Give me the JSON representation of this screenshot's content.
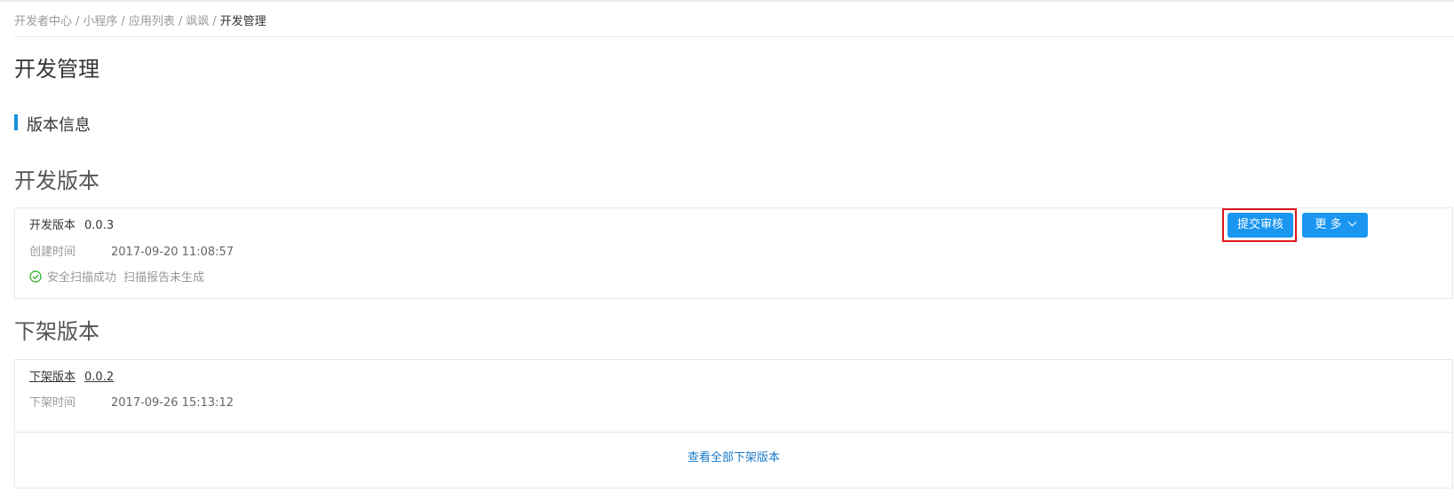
{
  "breadcrumb": {
    "items": [
      "开发者中心",
      "小程序",
      "应用列表",
      "飒飒",
      "开发管理"
    ],
    "separator": "/"
  },
  "page_title": "开发管理",
  "section_title": "版本信息",
  "dev_group": {
    "title": "开发版本",
    "version_label": "开发版本",
    "version_value": "0.0.3",
    "created_label": "创建时间",
    "created_value": "2017-09-20 11:08:57",
    "scan_status": "安全扫描成功",
    "scan_report": "扫描报告未生成",
    "submit_button": "提交审核",
    "more_button": "更 多"
  },
  "offline_group": {
    "title": "下架版本",
    "version_label": "下架版本",
    "version_value": "0.0.2",
    "offline_time_label": "下架时间",
    "offline_time_value": "2017-09-26 15:13:12",
    "view_all_link": "查看全部下架版本"
  },
  "colors": {
    "primary_button": "#1a96f0",
    "highlight_border": "#e0161f",
    "section_accent": "#1296db",
    "success_icon": "#1aad19",
    "link": "#1a7ac8"
  }
}
